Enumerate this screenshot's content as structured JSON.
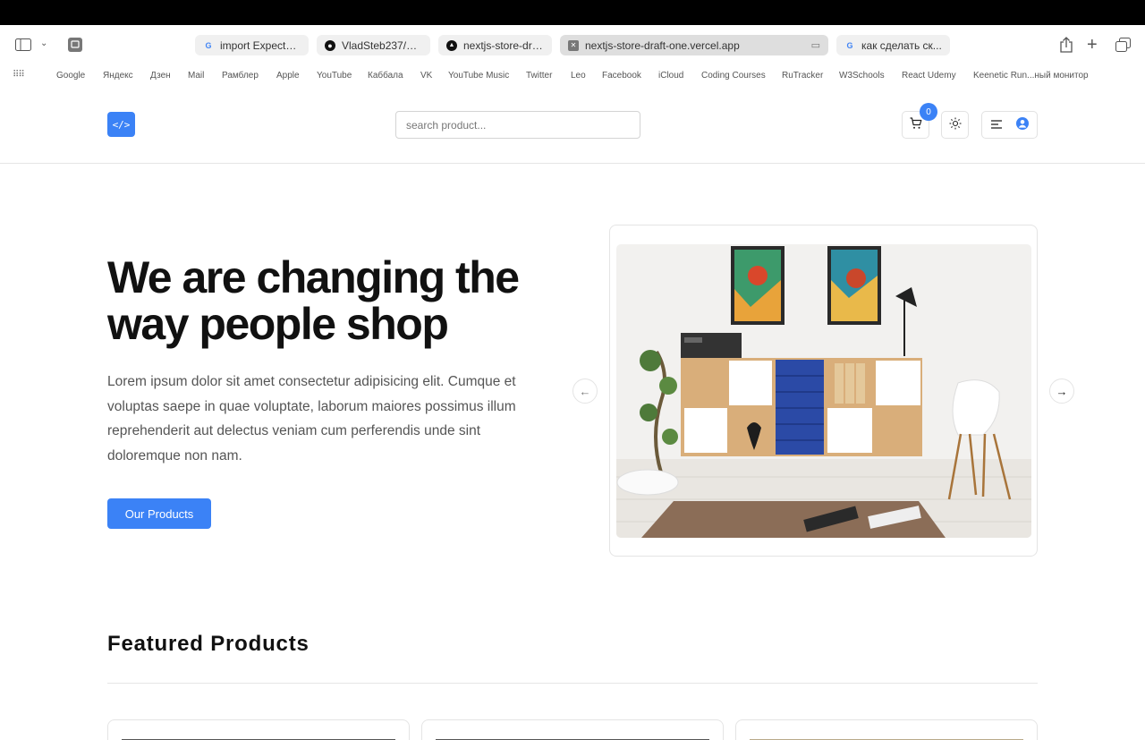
{
  "browser": {
    "tabs": [
      {
        "title": "import Expecte...",
        "favicon": "google-icon"
      },
      {
        "title": "VladSteb237/co...",
        "favicon": "github-icon"
      },
      {
        "title": "nextjs-store-dra...",
        "favicon": "vercel-icon"
      },
      {
        "title": "nextjs-store-draft-one.vercel.app",
        "favicon": "close-icon",
        "active": true
      },
      {
        "title": "как сделать ск...",
        "favicon": "google-icon"
      }
    ],
    "bookmarks": [
      "Google",
      "Яндекс",
      "Дзен",
      "Mail",
      "Рамблер",
      "Apple",
      "YouTube",
      "Каббала",
      "VK",
      "YouTube Music",
      "Twitter",
      "Leo",
      "Facebook",
      "iCloud",
      "Coding Courses",
      "RuTracker",
      "W3Schools",
      "React Udemy",
      "Keenetic Run...ный монитор"
    ]
  },
  "navbar": {
    "logo_text": "</>",
    "search_placeholder": "search product...",
    "cart_count": "0",
    "accent_color": "#3b82f6"
  },
  "hero": {
    "title": "We are changing the way people shop",
    "description": "Lorem ipsum dolor sit amet consectetur adipisicing elit. Cumque et voluptas saepe in quae voluptate, laborum maiores possimus illum reprehenderit aut delectus veniam cum perferendis unde sint doloremque non nam.",
    "cta_label": "Our Products"
  },
  "featured": {
    "title": "Featured Products"
  }
}
